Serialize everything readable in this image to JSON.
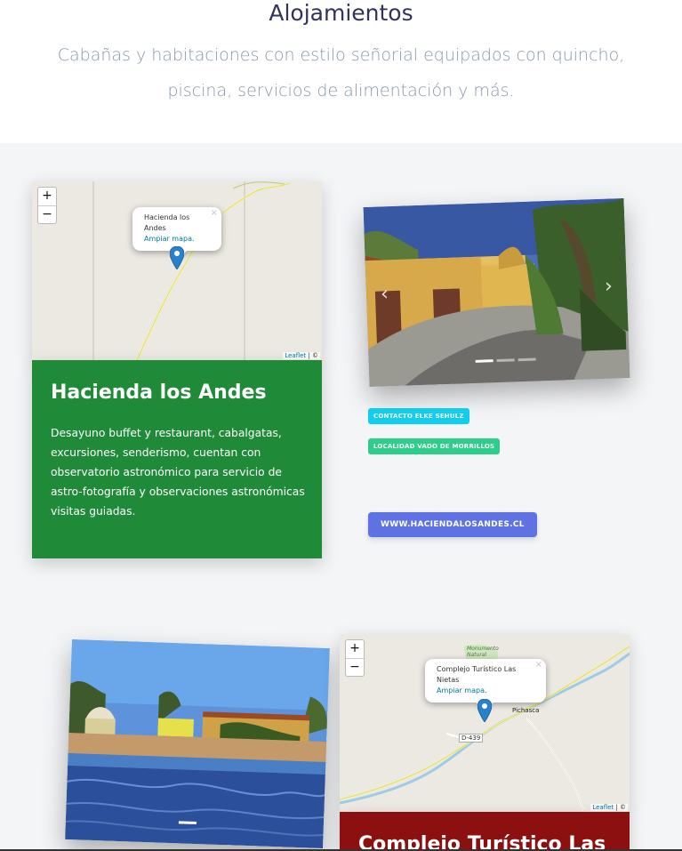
{
  "section": {
    "title": "Alojamientos",
    "subtitle": "Cabañas y habitaciones con estilo señorial equipados con quincho, piscina, servicios de alimentación y más."
  },
  "listings": [
    {
      "name": "Hacienda los Andes",
      "description": "Desayuno buffet y restaurant, cabalgatas, excursiones, senderismo, cuentan con observatorio astronómico para servicio de astro-fotografía y observaciones astronómicas visitas guiadas.",
      "card_color": "#1f8b38",
      "map": {
        "zoom_in": "+",
        "zoom_out": "−",
        "popup_title": "Hacienda los Andes",
        "popup_link": "Ampiar mapa.",
        "popup_close": "×",
        "attribution_link": "Leaflet",
        "attribution_rest": " | ©"
      },
      "badges": [
        {
          "label": "CONTACTO ELKE SEHULZ",
          "color": "#11cdef"
        },
        {
          "label": "LOCALIDAD VADO DE MORRILLOS",
          "color": "#2dce89"
        }
      ],
      "website_button": "WWW.HACIENDALOSANDES.CL",
      "carousel": {
        "prev_icon": "‹",
        "next_icon": "›",
        "slides": 3,
        "active_slide": 1
      }
    },
    {
      "name": "Complejo Turístico Las",
      "card_color": "#8c1010",
      "map": {
        "zoom_in": "+",
        "zoom_out": "−",
        "popup_title": "Complejo Turístico Las Nietas",
        "popup_link": "Ampiar mapa.",
        "popup_close": "×",
        "attribution_link": "Leaflet",
        "attribution_rest": " | ©",
        "labels": {
          "town": "Pichasca",
          "monument": "Monumento Natural",
          "road": "D-439"
        }
      },
      "carousel": {
        "slides": 1,
        "active_slide": 1
      }
    }
  ]
}
